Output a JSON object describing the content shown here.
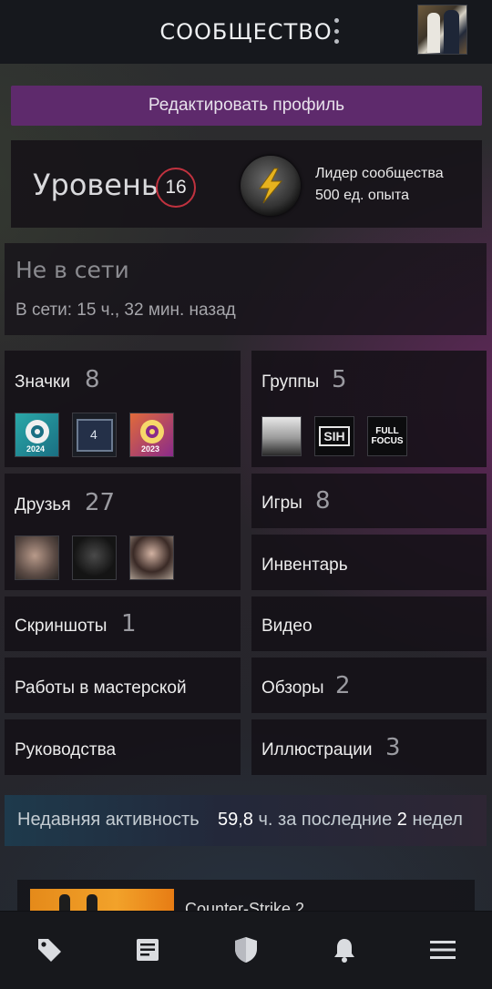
{
  "header": {
    "title": "СООБЩЕСТВО",
    "menu_icon": "kebab-menu-icon",
    "avatar_icon": "user-avatar"
  },
  "profile": {
    "edit_button": "Редактировать профиль",
    "level_label": "Уровень",
    "level_value": "16",
    "badge_title": "Лидер сообщества",
    "badge_xp": "500 ед. опыта"
  },
  "status": {
    "state": "Не в сети",
    "last_seen": "В сети: 15 ч., 32 мин. назад"
  },
  "tiles": {
    "badges": {
      "label": "Значки",
      "count": "8",
      "thumbs": [
        "2024",
        "4",
        "2023"
      ]
    },
    "groups": {
      "label": "Группы",
      "count": "5",
      "thumbs": [
        "",
        "SIH",
        "FULL FOCUS"
      ]
    },
    "friends": {
      "label": "Друзья",
      "count": "27"
    },
    "games": {
      "label": "Игры",
      "count": "8"
    },
    "inventory": {
      "label": "Инвентарь"
    },
    "screenshots": {
      "label": "Скриншоты",
      "count": "1"
    },
    "videos": {
      "label": "Видео"
    },
    "workshop": {
      "label": "Работы в мастерской"
    },
    "reviews": {
      "label": "Обзоры",
      "count": "2"
    },
    "guides": {
      "label": "Руководства"
    },
    "artwork": {
      "label": "Иллюстрации",
      "count": "3"
    }
  },
  "activity": {
    "label": "Недавняя активность",
    "hours": "59,8",
    "hours_suffix": "ч. за последние",
    "weeks": "2",
    "weeks_suffix": "недел",
    "game_name": "Counter-Strike 2"
  },
  "bottom_nav": [
    {
      "icon": "tag-icon"
    },
    {
      "icon": "news-icon"
    },
    {
      "icon": "shield-icon"
    },
    {
      "icon": "bell-icon"
    },
    {
      "icon": "hamburger-menu-icon"
    }
  ],
  "colors": {
    "accent_purple": "#5e2a6c",
    "level_ring": "#c1323f",
    "background": "#16171b"
  }
}
